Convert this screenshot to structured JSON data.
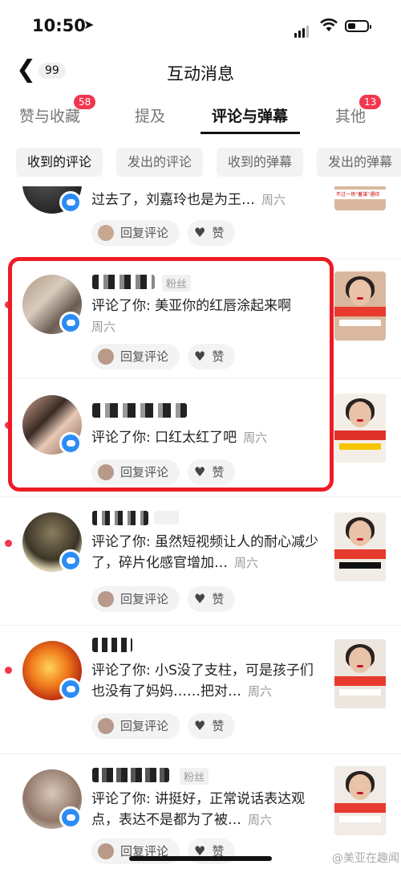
{
  "status": {
    "time": "10:50",
    "location_icon": "location-arrow-icon"
  },
  "nav": {
    "back_icon": "chevron-left-icon",
    "count": "99",
    "title": "互动消息"
  },
  "tabs": [
    {
      "label": "赞与收藏",
      "badge": "58"
    },
    {
      "label": "提及"
    },
    {
      "label": "评论与弹幕",
      "active": true
    },
    {
      "label": "其他",
      "badge": "13"
    }
  ],
  "chips": [
    "收到的评论",
    "发出的评论",
    "收到的弹幕",
    "发出的弹幕"
  ],
  "items": [
    {
      "text": "过去了，刘嘉玲也是为王…",
      "time": "周六",
      "reply": "回复评论",
      "like": "赞",
      "thumb_caption": "不过一场“蓄谋”遇待"
    },
    {
      "fans": "粉丝",
      "text": "评论了你: 美亚你的红唇涂起来啊",
      "time": "周六",
      "reply": "回复评论",
      "like": "赞",
      "unread": true
    },
    {
      "text": "评论了你: 口红太红了吧",
      "time": "周六",
      "reply": "回复评论",
      "like": "赞",
      "unread": true
    },
    {
      "text": "评论了你: 虽然短视频让人的耐心减少了，碎片化感官增加…",
      "time": "周六",
      "reply": "回复评论",
      "like": "赞",
      "unread": true
    },
    {
      "text": "评论了你: 小S没了支柱，可是孩子们也没有了妈妈……把对…",
      "time": "周六",
      "reply": "回复评论",
      "like": "赞",
      "unread": true
    },
    {
      "fans": "粉丝",
      "text": "评论了你: 讲挺好，正常说话表达观点，表达不是都为了被…",
      "time": "周六",
      "reply": "回复评论",
      "like": "赞"
    }
  ],
  "watermark": "@美亚在趣闻",
  "colors": {
    "accent": "#f2364e",
    "highlight": "#ee1c25",
    "message_badge": "#2b8cf5"
  }
}
